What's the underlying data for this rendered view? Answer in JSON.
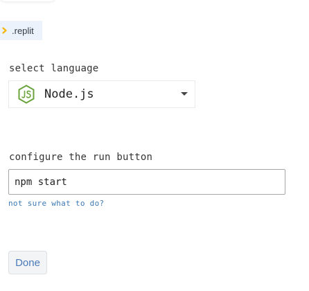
{
  "replit_tag": {
    "label": ".replit",
    "icon": "chevron-right-icon",
    "icon_color": "#f5b60a"
  },
  "language": {
    "section_label": "select language",
    "selected": "Node.js",
    "icon": "nodejs-icon",
    "icon_color": "#6ba33d"
  },
  "run_button": {
    "section_label": "configure the run button",
    "command_value": "npm start",
    "help_link": "not sure what to do?"
  },
  "footer": {
    "done_label": "Done"
  },
  "colors": {
    "link": "#3b79b6",
    "done_text": "#4a7ab8",
    "tag_background": "#ebf2fb"
  }
}
